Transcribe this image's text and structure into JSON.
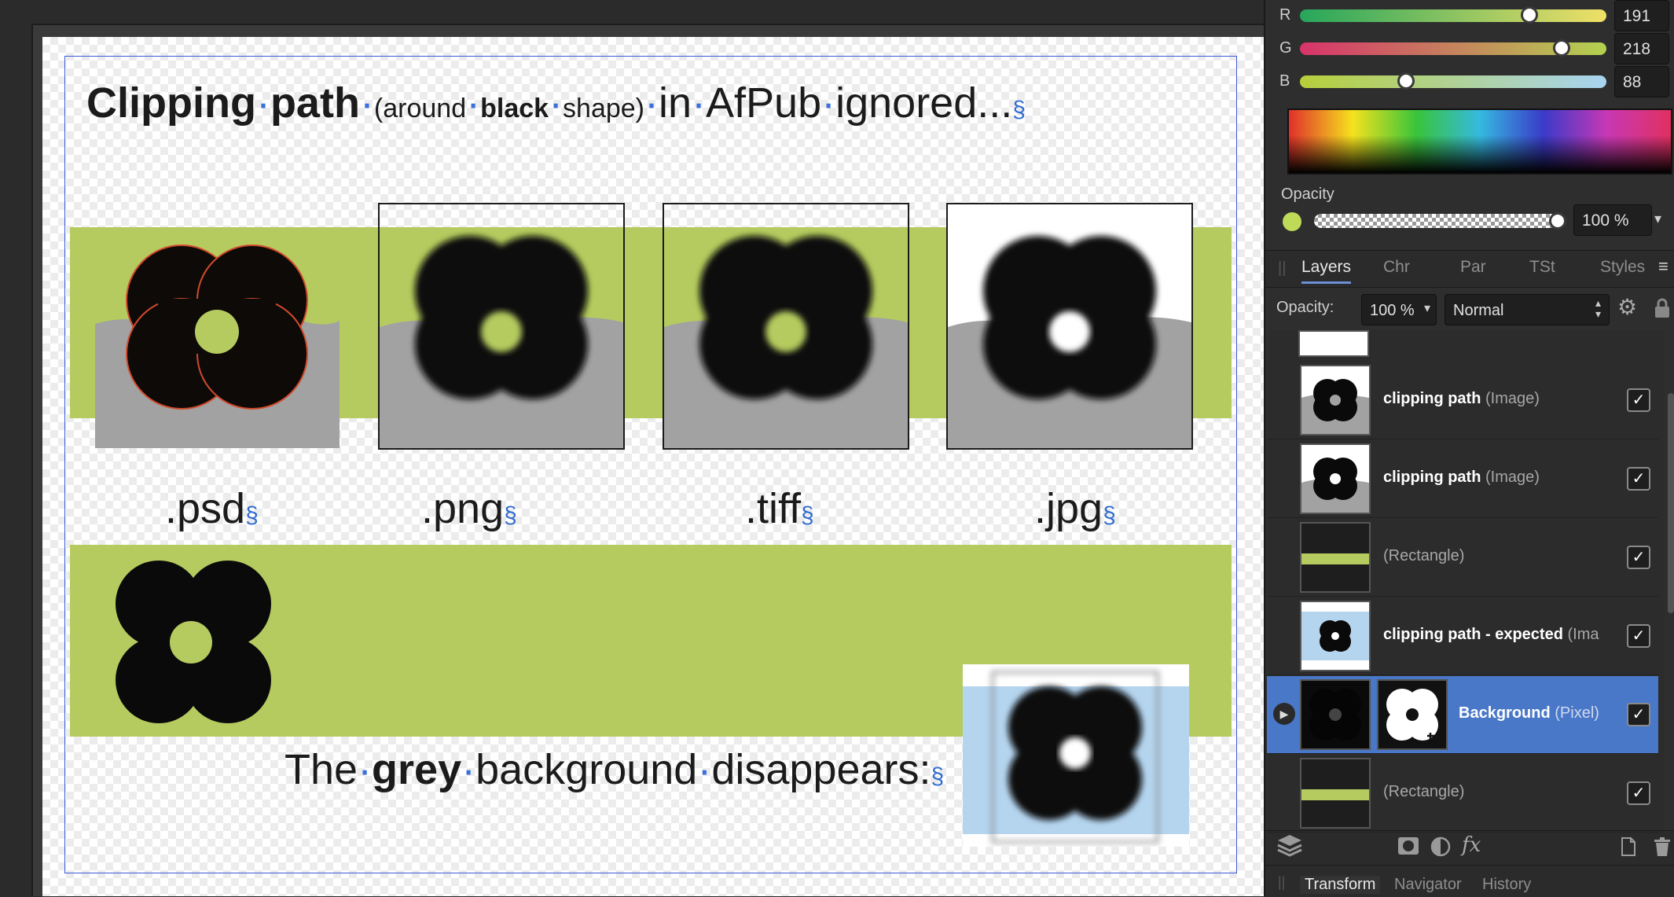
{
  "document": {
    "title_part1": "Clipping",
    "title_part2": "path",
    "title_part3": "(around",
    "title_part4": "black",
    "title_part5": "shape)",
    "title_part6": "in",
    "title_part7": "AfPub",
    "title_part8": "ignored...",
    "pilcrow": "§",
    "ext_psd": ".psd",
    "ext_png": ".png",
    "ext_tiff": ".tiff",
    "ext_jpg": ".jpg",
    "bottom_part1": "The",
    "bottom_part2": "grey",
    "bottom_part3": "background",
    "bottom_part4": "disappears:"
  },
  "color": {
    "r_label": "R",
    "g_label": "G",
    "b_label": "B",
    "r_value": "191",
    "g_value": "218",
    "b_value": "88",
    "opacity_label": "Opacity",
    "opacity_value": "100 %",
    "r_fraction": 0.749,
    "g_fraction": 0.855,
    "b_fraction": 0.345,
    "swatch": "#bfda58"
  },
  "tabs": [
    "Layers",
    "Chr",
    "Par",
    "TSt",
    "Styles"
  ],
  "layer_toolbar": {
    "opacity_label": "Opacity:",
    "opacity_value": "100 %",
    "blend_mode": "Normal"
  },
  "layers": [
    {
      "name": "clipping path",
      "type": "(Image)",
      "checked": "✓"
    },
    {
      "name": "clipping path",
      "type": "(Image)",
      "checked": "✓"
    },
    {
      "name": "",
      "type": "(Rectangle)",
      "checked": "✓"
    },
    {
      "name": "clipping path - expected",
      "type": "(Ima",
      "checked": "✓"
    },
    {
      "name": "Background",
      "type": "(Pixel)",
      "checked": "✓"
    },
    {
      "name": "",
      "type": "(Rectangle)",
      "checked": "✓"
    }
  ],
  "bottom_tabs": [
    "Transform",
    "Navigator",
    "History"
  ],
  "colors": {
    "accent_green": "#b5cb5f",
    "selection_blue": "#4a78c8",
    "frame_blue": "#3b5bd9"
  }
}
